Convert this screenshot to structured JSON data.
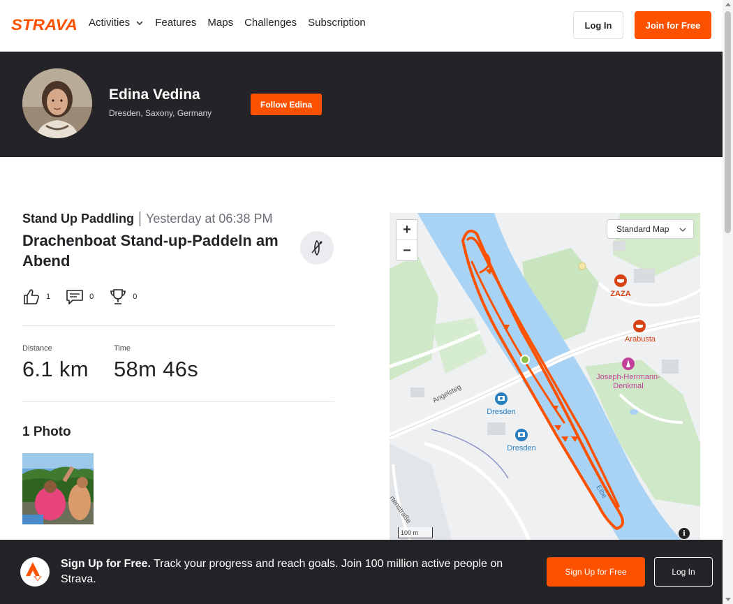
{
  "nav": {
    "logo_text": "STRAVA",
    "links": [
      "Activities",
      "Features",
      "Maps",
      "Challenges",
      "Subscription"
    ],
    "login_label": "Log In",
    "join_label": "Join for Free"
  },
  "athlete": {
    "name": "Edina Vedina",
    "location": "Dresden, Saxony, Germany",
    "follow_label": "Follow Edina"
  },
  "activity": {
    "type": "Stand Up Paddling",
    "time": "Yesterday at 06:38 PM",
    "title": "Drachenboat Stand-up-Paddeln am Abend",
    "kudos": "1",
    "comments": "0",
    "achievements": "0"
  },
  "stats": [
    {
      "label": "Distance",
      "value": "6.1 km"
    },
    {
      "label": "Time",
      "value": "58m 46s"
    }
  ],
  "photos": {
    "heading": "1 Photo"
  },
  "map": {
    "map_type": "Standard Map",
    "scale_label": "100 m",
    "zoom_in": "+",
    "zoom_out": "−",
    "info": "i",
    "labels": {
      "zaza": "ZAZA",
      "arabusta": "Arabusta",
      "denkmal": "Joseph-Herrmann-Denkmal",
      "dresden1": "Dresden",
      "dresden2": "Dresden",
      "angelsteg": "Angelsteg",
      "street": "rtenstraße",
      "river": "Elbe"
    },
    "colors": {
      "route": "#fc5200",
      "river": "#a9d3f5",
      "park": "#c8e6c1"
    }
  },
  "banner": {
    "headline": "Sign Up for Free.",
    "text": "Track your progress and reach goals. Join 100 million active people on Strava.",
    "signup_label": "Sign Up for Free",
    "login_label": "Log In"
  },
  "colors": {
    "brand": "#fc5200",
    "dark": "#242428"
  }
}
